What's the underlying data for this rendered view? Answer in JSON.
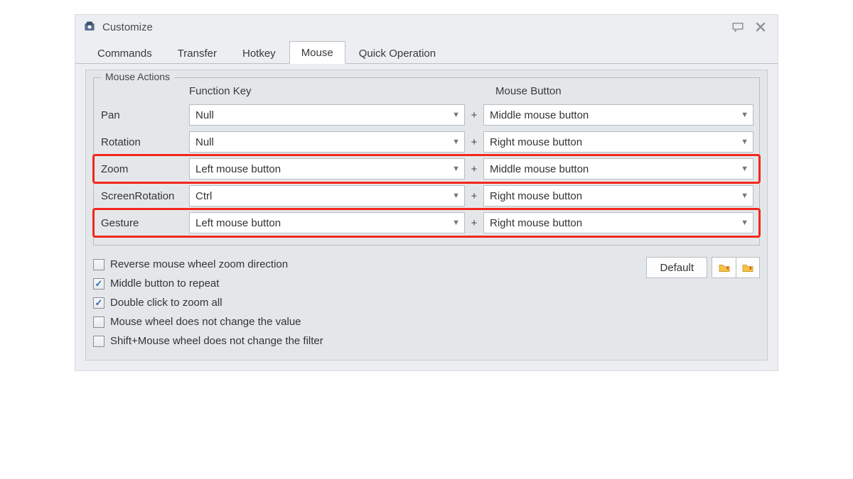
{
  "window": {
    "title": "Customize"
  },
  "tabs": {
    "items": [
      {
        "label": "Commands",
        "active": false
      },
      {
        "label": "Transfer",
        "active": false
      },
      {
        "label": "Hotkey",
        "active": false
      },
      {
        "label": "Mouse",
        "active": true
      },
      {
        "label": "Quick Operation",
        "active": false
      }
    ]
  },
  "mouse_actions": {
    "legend": "Mouse Actions",
    "headers": {
      "function_key": "Function Key",
      "mouse_button": "Mouse Button"
    },
    "rows": [
      {
        "label": "Pan",
        "fk": "Null",
        "mb": "Middle mouse button",
        "highlight": false
      },
      {
        "label": "Rotation",
        "fk": "Null",
        "mb": "Right mouse button",
        "highlight": false
      },
      {
        "label": "Zoom",
        "fk": "Left mouse button",
        "mb": "Middle mouse button",
        "highlight": true
      },
      {
        "label": "ScreenRotation",
        "fk": "Ctrl",
        "mb": "Right mouse button",
        "highlight": false
      },
      {
        "label": "Gesture",
        "fk": "Left mouse button",
        "mb": "Right mouse button",
        "highlight": true
      }
    ],
    "plus": "+"
  },
  "options": {
    "reverse_wheel": {
      "label": "Reverse mouse wheel zoom direction",
      "checked": false
    },
    "middle_repeat": {
      "label": "Middle button to repeat",
      "checked": true
    },
    "dbl_zoom_all": {
      "label": "Double click to zoom all",
      "checked": true
    },
    "wheel_no_value": {
      "label": "Mouse wheel does not change the value",
      "checked": false
    },
    "shift_wheel_no_filter": {
      "label": "Shift+Mouse wheel does not change the filter",
      "checked": false
    }
  },
  "buttons": {
    "default": "Default"
  }
}
